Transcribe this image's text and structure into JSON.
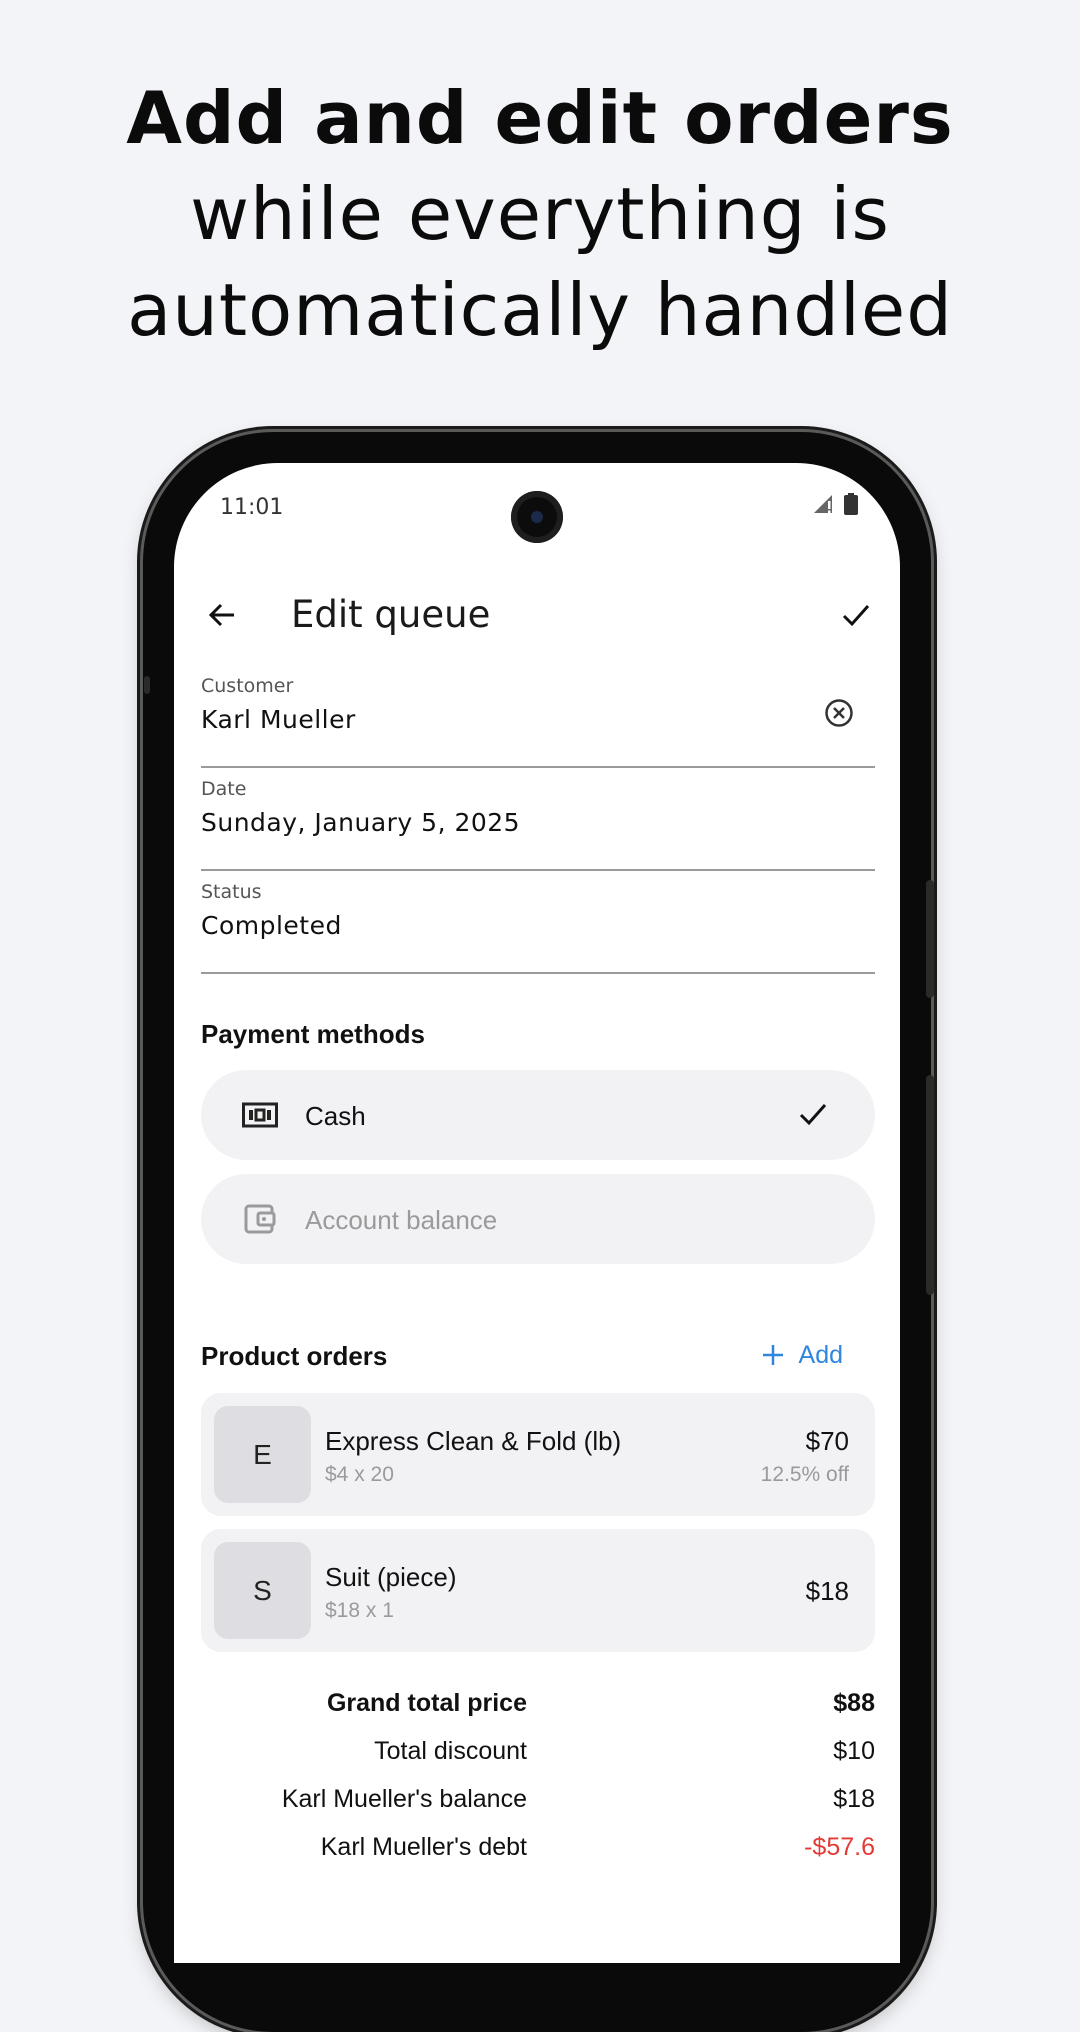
{
  "headline": {
    "line1": "Add and edit orders",
    "line2": "while everything is",
    "line3": "automatically handled"
  },
  "status_bar": {
    "time": "11:01"
  },
  "appbar": {
    "title": "Edit queue"
  },
  "fields": {
    "customer": {
      "label": "Customer",
      "value": "Karl Mueller"
    },
    "date": {
      "label": "Date",
      "value": "Sunday, January 5, 2025"
    },
    "status": {
      "label": "Status",
      "value": "Completed"
    }
  },
  "payment": {
    "title": "Payment methods",
    "options": [
      {
        "label": "Cash",
        "icon": "cash-icon",
        "selected": true
      },
      {
        "label": "Account balance",
        "icon": "wallet-icon",
        "selected": false
      }
    ]
  },
  "products": {
    "title": "Product orders",
    "add_label": "Add",
    "items": [
      {
        "initial": "E",
        "name": "Express Clean & Fold (lb)",
        "qty": "$4 x 20",
        "price": "$70",
        "discount": "12.5% off"
      },
      {
        "initial": "S",
        "name": "Suit (piece)",
        "qty": "$18 x 1",
        "price": "$18"
      }
    ]
  },
  "totals": [
    {
      "label": "Grand total price",
      "value": "$88",
      "bold": true
    },
    {
      "label": "Total discount",
      "value": "$10"
    },
    {
      "label": "Karl Mueller's balance",
      "value": "$18"
    },
    {
      "label": "Karl Mueller's debt",
      "value": "-$57.6",
      "negative": true
    }
  ],
  "colors": {
    "accent": "#2e86de",
    "negative": "#e53935",
    "card_bg": "#f2f2f5",
    "page_bg": "#f3f4f7"
  }
}
